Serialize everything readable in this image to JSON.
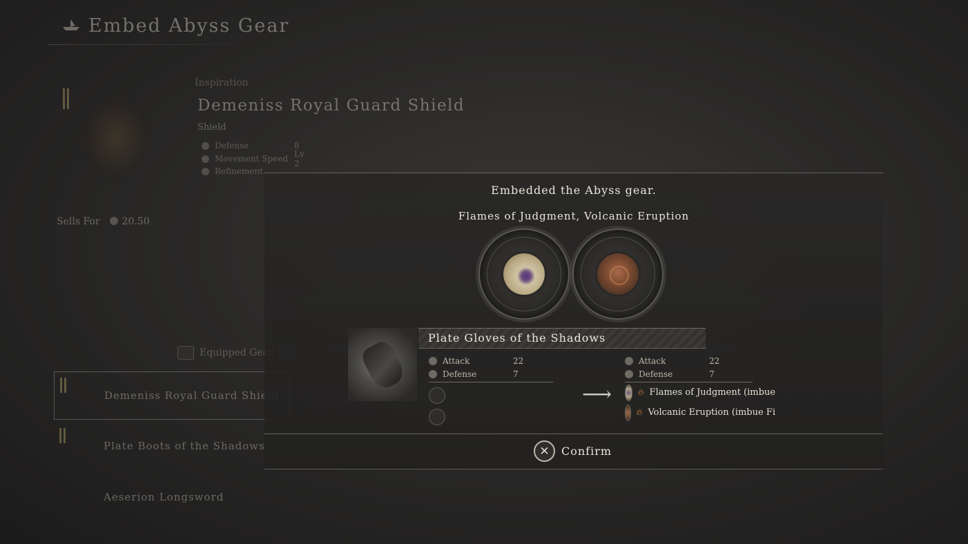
{
  "header": {
    "title": "Embed Abyss Gear",
    "icon": "ship-icon"
  },
  "inspected_item": {
    "tag": "Inspiration",
    "name": "Demeniss Royal Guard Shield",
    "type": "Shield",
    "stats": [
      {
        "label": "Defense",
        "value": "8"
      },
      {
        "label": "Movement Speed",
        "value": "Lv 2"
      },
      {
        "label": "Refinement",
        "value": ""
      }
    ],
    "sells_label": "Sells For",
    "sells_value": "20.50"
  },
  "equipped": {
    "label": "Equipped Gear",
    "items": [
      {
        "name": "Demeniss Royal Guard Shield",
        "selected": true
      },
      {
        "name": "Plate Boots of the Shadows",
        "selected": false
      },
      {
        "name": "Aeserion Longsword",
        "selected": false
      }
    ]
  },
  "modal": {
    "title": "Embedded the Abyss gear.",
    "gear_names": "Flames of Judgment, Volcanic Eruption",
    "sockets": [
      "eye-gem-icon",
      "volcanic-gem-icon"
    ],
    "gear_item": {
      "name": "Plate Gloves of the Shadows",
      "before": {
        "stats": [
          {
            "label": "Attack",
            "value": "22"
          },
          {
            "label": "Defense",
            "value": "7"
          }
        ]
      },
      "after": {
        "stats": [
          {
            "label": "Attack",
            "value": "22"
          },
          {
            "label": "Defense",
            "value": "7"
          }
        ],
        "gems": [
          {
            "name": "Flames of Judgment (imbue"
          },
          {
            "name": "Volcanic Eruption (imbue Fi"
          }
        ]
      }
    },
    "confirm_label": "Confirm",
    "confirm_button_glyph": "✕"
  },
  "colors": {
    "accent_gold": "#b9a867",
    "flame": "#d4803f",
    "text_light": "#ece7dc"
  }
}
